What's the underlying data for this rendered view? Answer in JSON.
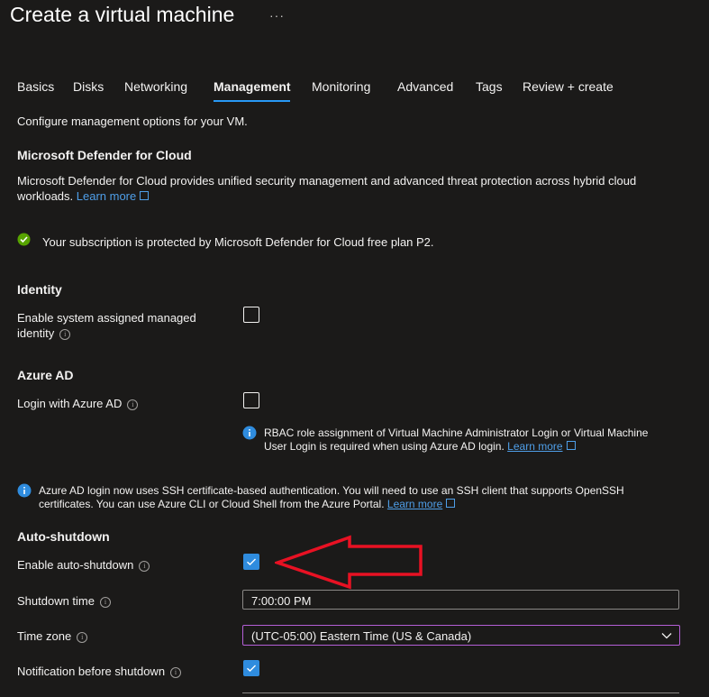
{
  "header": {
    "title": "Create a virtual machine",
    "more": "···"
  },
  "tabs": [
    {
      "label": "Basics"
    },
    {
      "label": "Disks"
    },
    {
      "label": "Networking"
    },
    {
      "label": "Management"
    },
    {
      "label": "Monitoring"
    },
    {
      "label": "Advanced"
    },
    {
      "label": "Tags"
    },
    {
      "label": "Review + create"
    }
  ],
  "active_tab": "Management",
  "intro": "Configure management options for your VM.",
  "defender": {
    "heading": "Microsoft Defender for Cloud",
    "desc_line1": "Microsoft Defender for Cloud provides unified security management and advanced threat protection across hybrid cloud",
    "desc_line2": "workloads.",
    "learn_more": "Learn more",
    "status": "Your subscription is protected by Microsoft Defender for Cloud free plan P2."
  },
  "identity": {
    "heading": "Identity",
    "label_line1": "Enable system assigned managed",
    "label_line2": "identity",
    "checked": false
  },
  "azure_ad": {
    "heading": "Azure AD",
    "login_label": "Login with Azure AD",
    "checked": false,
    "rbac_line1": "RBAC role assignment of Virtual Machine Administrator Login or Virtual Machine",
    "rbac_line2": "User Login is required when using Azure AD login.",
    "rbac_learn_more": "Learn more",
    "ssh_line1": "Azure AD login now uses SSH certificate-based authentication. You will need to use an SSH client that supports OpenSSH",
    "ssh_line2": "certificates. You can use Azure CLI or Cloud Shell from the Azure Portal.",
    "ssh_learn_more": "Learn more"
  },
  "auto_shutdown": {
    "heading": "Auto-shutdown",
    "enable_label": "Enable auto-shutdown",
    "enable_checked": true,
    "shutdown_time_label": "Shutdown time",
    "shutdown_time_value": "7:00:00 PM",
    "time_zone_label": "Time zone",
    "time_zone_value": "(UTC-05:00) Eastern Time (US & Canada)",
    "notification_label": "Notification before shutdown",
    "notification_checked": true
  },
  "colors": {
    "background": "#1b1a19",
    "accent": "#2899f5",
    "link": "#4f9fe9",
    "success": "#57a300",
    "annotation_arrow": "#e81123"
  }
}
